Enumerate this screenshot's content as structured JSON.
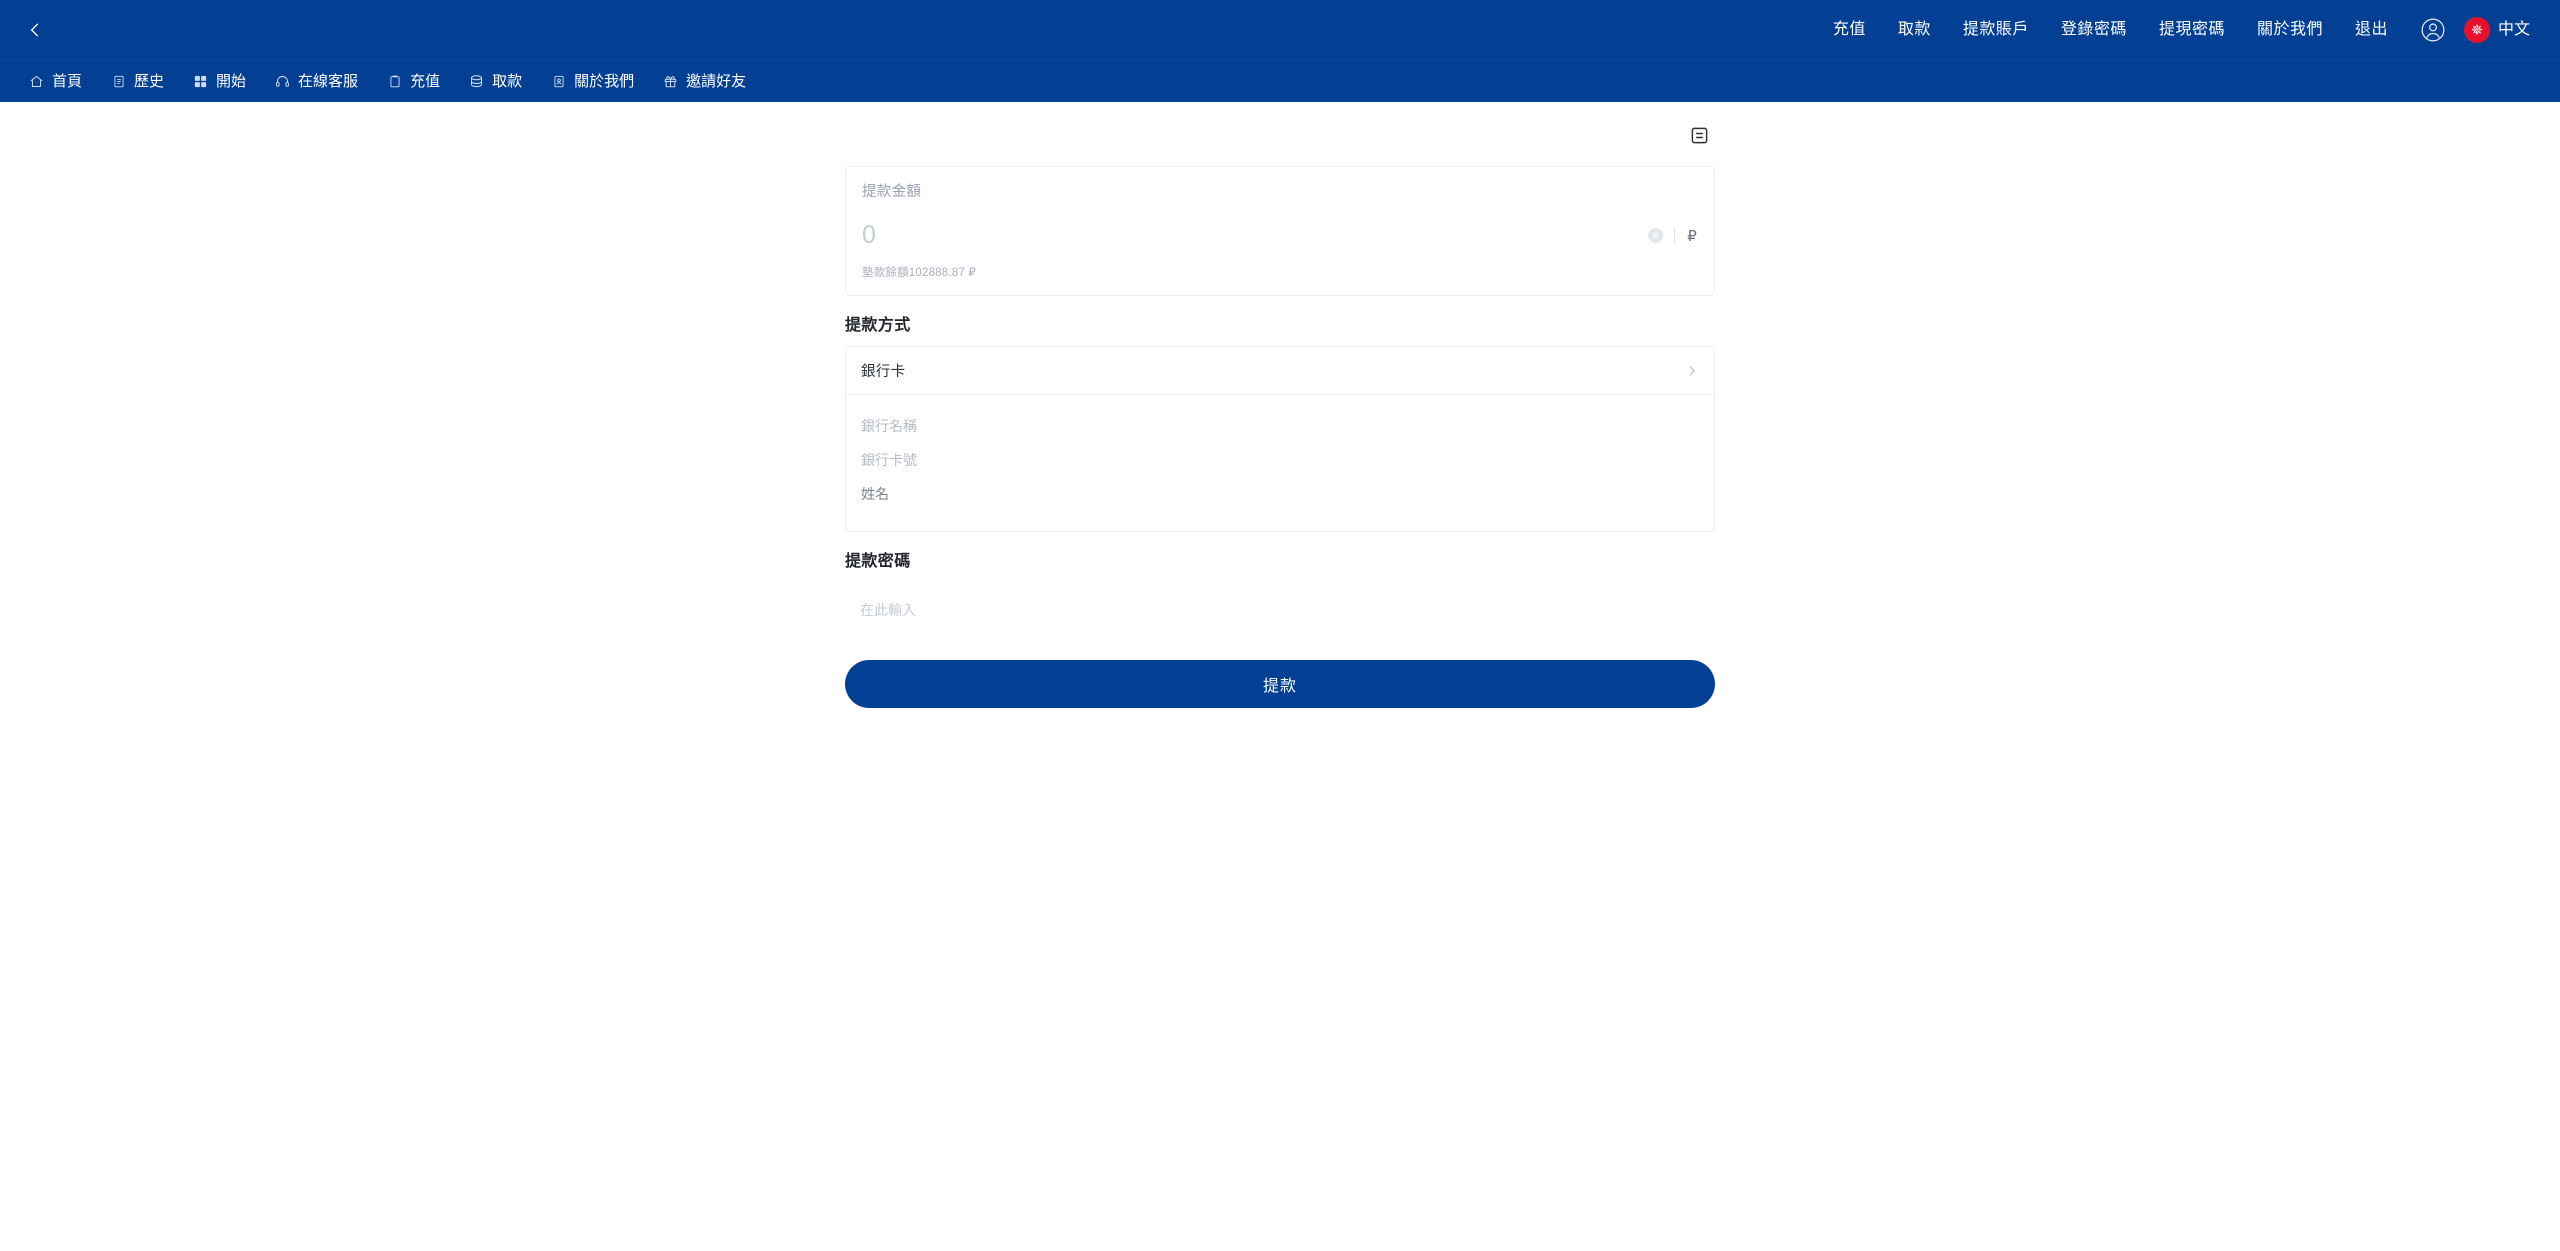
{
  "theme": {
    "brand_blue": "#034094",
    "flag_red": "#e8112d",
    "text_dark": "#24282e",
    "text_muted": "#9aa2ae",
    "placeholder": "#b6bcc6"
  },
  "header": {
    "back_icon": "chevron-left-icon",
    "nav_links": [
      {
        "label": "充值"
      },
      {
        "label": "取款"
      },
      {
        "label": "提款賬戶"
      },
      {
        "label": "登錄密碼"
      },
      {
        "label": "提現密碼"
      },
      {
        "label": "關於我們"
      },
      {
        "label": "退出"
      }
    ],
    "user_icon": "user-circle-icon",
    "language": {
      "flag_icon": "hongkong-flag-icon",
      "label": "中文"
    }
  },
  "subnav": {
    "items": [
      {
        "label": "首頁",
        "icon": "home-icon"
      },
      {
        "label": "歷史",
        "icon": "history-document-icon"
      },
      {
        "label": "開始",
        "icon": "grid-squares-icon"
      },
      {
        "label": "在線客服",
        "icon": "headset-icon"
      },
      {
        "label": "充值",
        "icon": "clipboard-icon"
      },
      {
        "label": "取款",
        "icon": "database-stack-icon"
      },
      {
        "label": "關於我們",
        "icon": "id-card-icon"
      },
      {
        "label": "邀請好友",
        "icon": "gift-icon"
      }
    ]
  },
  "main": {
    "record_button_icon": "record-list-icon",
    "amount": {
      "label": "提款金額",
      "value": "",
      "placeholder": "0",
      "clear_icon": "clear-circle-icon",
      "currency_symbol": "₽",
      "balance_note": "墊款餘額102888.87 ₽"
    },
    "method_section": {
      "title": "提款方式",
      "selected": {
        "label": "銀行卡",
        "chevron_icon": "chevron-right-icon"
      },
      "fields": [
        {
          "name": "bank-name",
          "value": "",
          "placeholder": "銀行名稱"
        },
        {
          "name": "bank-card-number",
          "value": "",
          "placeholder": "銀行卡號"
        },
        {
          "name": "account-holder-name",
          "value": "",
          "placeholder": "姓名"
        }
      ]
    },
    "password_section": {
      "title": "提款密碼",
      "value": "",
      "placeholder": "在此輸入"
    },
    "submit": {
      "label": "提款"
    }
  }
}
